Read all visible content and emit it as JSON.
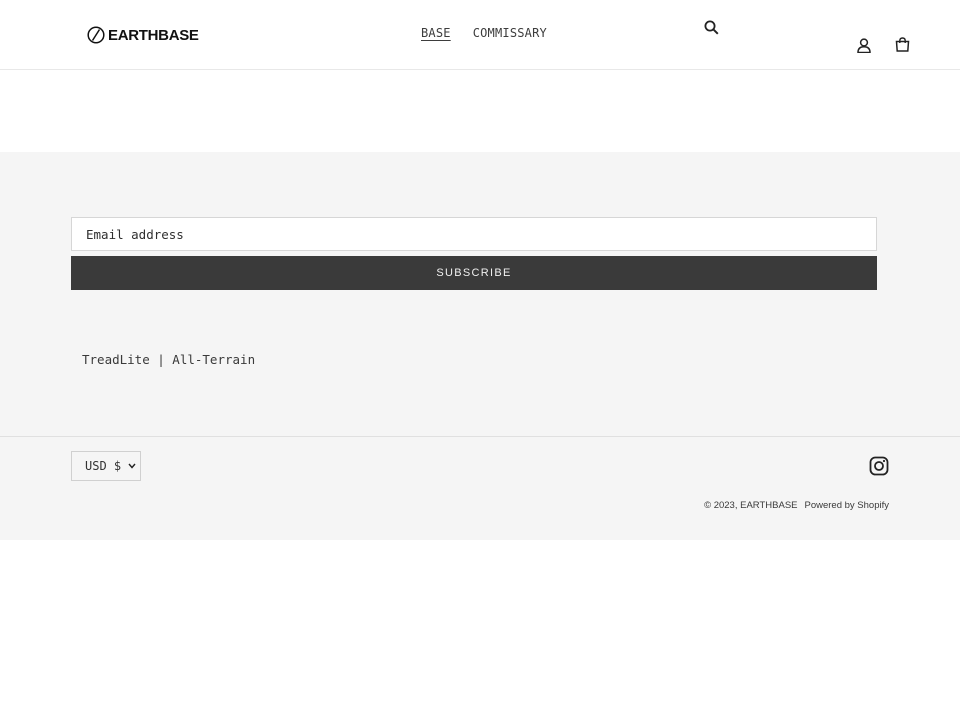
{
  "header": {
    "brand": "EARTHBASE",
    "nav": [
      {
        "label": "BASE",
        "active": true
      },
      {
        "label": "COMMISSARY",
        "active": false
      }
    ],
    "icons": [
      "search-icon",
      "account-icon",
      "cart-icon"
    ]
  },
  "footer": {
    "newsletter": {
      "placeholder": "Email address",
      "button": "SUBSCRIBE"
    },
    "tagline": "TreadLite | All-Terrain",
    "currency": "USD $",
    "social_icon": "instagram-icon",
    "copyright": "© 2023, EARTHBASE",
    "powered_by": "Powered by Shopify"
  },
  "colors": {
    "footer_bg": "#f5f5f5",
    "button_bg": "#3a3a3a",
    "text": "#3a3a3a"
  }
}
